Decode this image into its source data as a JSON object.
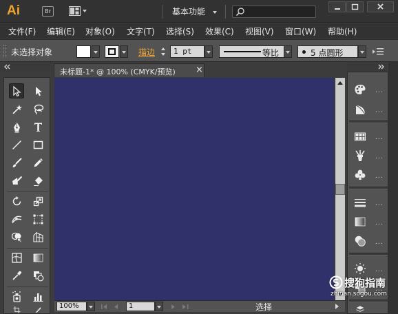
{
  "titlebar": {
    "logo": "Ai",
    "bridge": "Br",
    "workspace": "基本功能"
  },
  "menu": [
    {
      "label": "文件(F)"
    },
    {
      "label": "编辑(E)"
    },
    {
      "label": "对象(O)"
    },
    {
      "label": "文字(T)"
    },
    {
      "label": "选择(S)"
    },
    {
      "label": "效果(C)"
    },
    {
      "label": "视图(V)"
    },
    {
      "label": "窗口(W)"
    },
    {
      "label": "帮助(H)"
    }
  ],
  "control": {
    "selection_status": "未选择对象",
    "stroke_label": "描边",
    "stroke_weight": "1 pt",
    "stroke_profile": "等比",
    "brush": "5 点圆形"
  },
  "document": {
    "tab_title": "未标题-1* @ 100% (CMYK/预览)",
    "close_glyph": "×",
    "canvas_color": "#30306a"
  },
  "status": {
    "zoom": "100%",
    "artboard": "1",
    "tool_label": "选择"
  },
  "watermark": {
    "brand": "搜狗指南",
    "url": "zhinan.sogou.com"
  },
  "colors": {
    "accent": "#f2a42a",
    "stroke_label": "#f0a83c",
    "chrome_dark": "#323232",
    "panel": "#535353"
  }
}
